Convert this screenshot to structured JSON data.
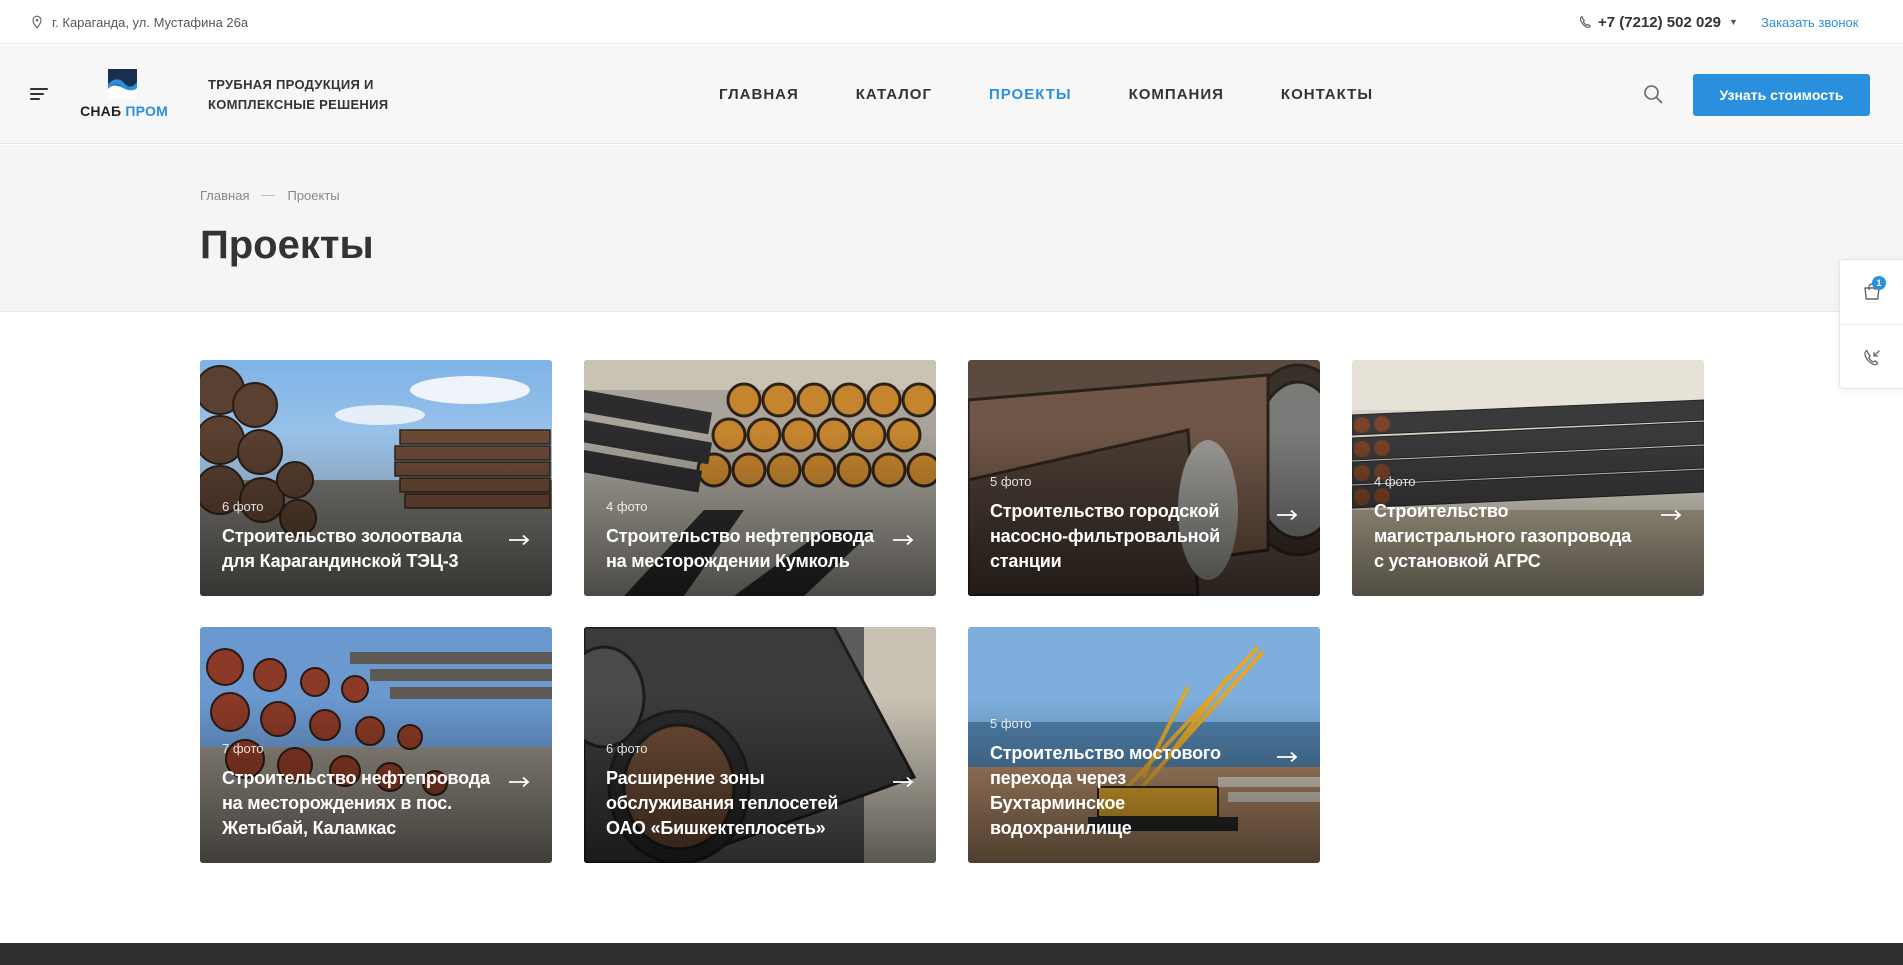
{
  "topbar": {
    "address": "г. Караганда, ул. Мустафина 26а",
    "phone": "+7 (7212) 502 029",
    "callback_label": "Заказать звонок"
  },
  "header": {
    "logo_part1": "СНАБ",
    "logo_part2": "ПРОМ",
    "tagline": "ТРУБНАЯ ПРОДУКЦИЯ И КОМПЛЕКСНЫЕ РЕШЕНИЯ",
    "nav": [
      {
        "label": "ГЛАВНАЯ",
        "active": false
      },
      {
        "label": "КАТАЛОГ",
        "active": false
      },
      {
        "label": "ПРОЕКТЫ",
        "active": true
      },
      {
        "label": "КОМПАНИЯ",
        "active": false
      },
      {
        "label": "КОНТАКТЫ",
        "active": false
      }
    ],
    "cta_label": "Узнать стоимость"
  },
  "breadcrumb": [
    "Главная",
    "Проекты"
  ],
  "page_title": "Проекты",
  "side_widget": {
    "cart_count": "1",
    "items": [
      "cart-icon",
      "callback-icon"
    ]
  },
  "projects": [
    {
      "count": "6 фото",
      "title": "Строительство золоотвала для Карагандинской ТЭЦ-3"
    },
    {
      "count": "4 фото",
      "title": "Строительство нефтепровода на месторождении Кумколь"
    },
    {
      "count": "5 фото",
      "title": "Строительство городской насосно-фильтровальной станции"
    },
    {
      "count": "4 фото",
      "title": "Строительство магистрального газопровода с установкой АГРС"
    },
    {
      "count": "7 фото",
      "title": "Строительство нефтепровода на месторождениях в пос. Жетыбай, Каламкас"
    },
    {
      "count": "6 фото",
      "title": "Расширение зоны обслуживания теплосетей ОАО «Бишкектеплосеть»"
    },
    {
      "count": "5 фото",
      "title": "Строительство мостового перехода через Бухтарминское водохранилище"
    }
  ],
  "colors": {
    "accent": "#2a8fdc",
    "text": "#333333",
    "footer": "#2f2f2f"
  }
}
